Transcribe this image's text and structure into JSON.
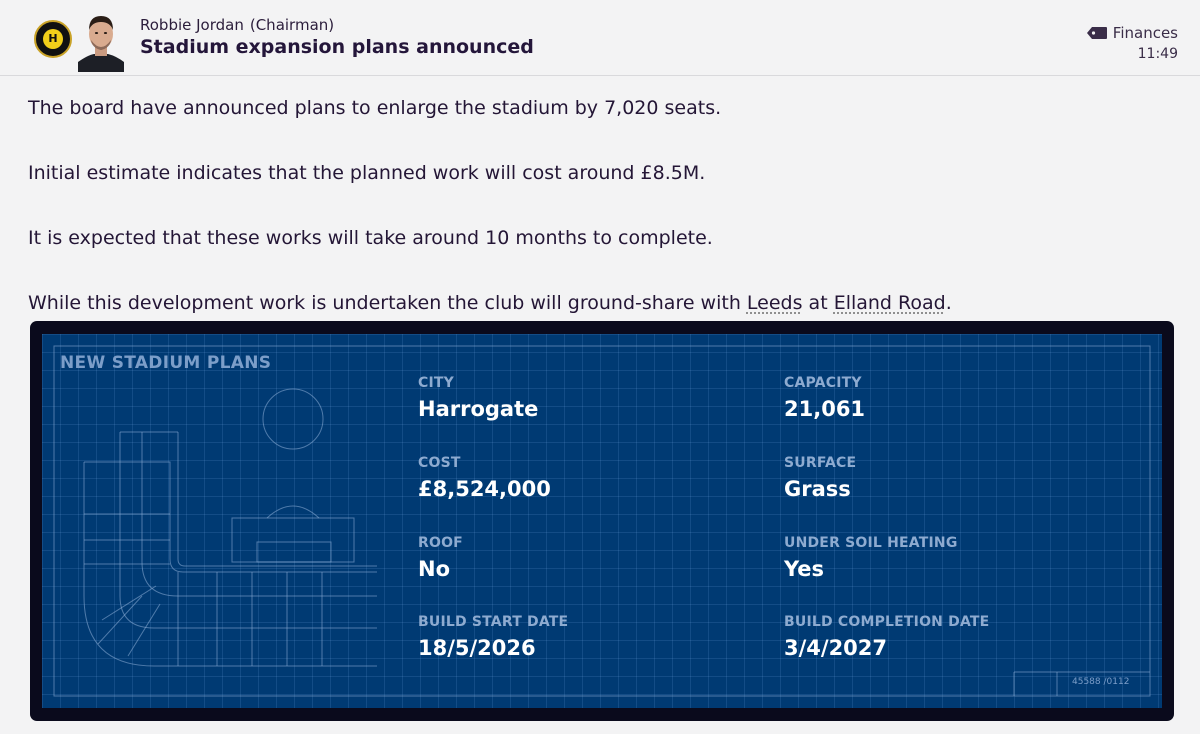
{
  "message": {
    "sender_name": "Robbie Jordan",
    "sender_role": "(Chairman)",
    "subject": "Stadium expansion plans announced",
    "category": "Finances",
    "time": "11:49",
    "club_badge_letter": "H"
  },
  "body": {
    "p1": "The board have announced plans to enlarge the stadium by 7,020 seats.",
    "p2": "Initial estimate indicates that the planned work will cost around £8.5M.",
    "p3": "It is expected that these works will take around 10 months to complete.",
    "p4_before": "While this development work is undertaken the club will ground-share with ",
    "p4_link1": "Leeds",
    "p4_middle": " at ",
    "p4_link2": "Elland Road",
    "p4_after": "."
  },
  "plans": {
    "title": "NEW STADIUM PLANS",
    "city_label": "CITY",
    "city": "Harrogate",
    "capacity_label": "CAPACITY",
    "capacity": "21,061",
    "cost_label": "COST",
    "cost": "£8,524,000",
    "surface_label": "SURFACE",
    "surface": "Grass",
    "roof_label": "ROOF",
    "roof": "No",
    "heating_label": "UNDER SOIL HEATING",
    "heating": "Yes",
    "start_label": "BUILD START DATE",
    "start": "18/5/2026",
    "completion_label": "BUILD COMPLETION DATE",
    "completion": "3/4/2027",
    "drawing_code": "45588 /0112"
  },
  "colors": {
    "blueprint_bg": "#003a73",
    "frame": "#0a0a1c",
    "label": "#8eabd0",
    "value": "#ffffff"
  },
  "icons": {
    "category": "tag-icon",
    "club": "club-badge-icon",
    "sender": "avatar"
  }
}
